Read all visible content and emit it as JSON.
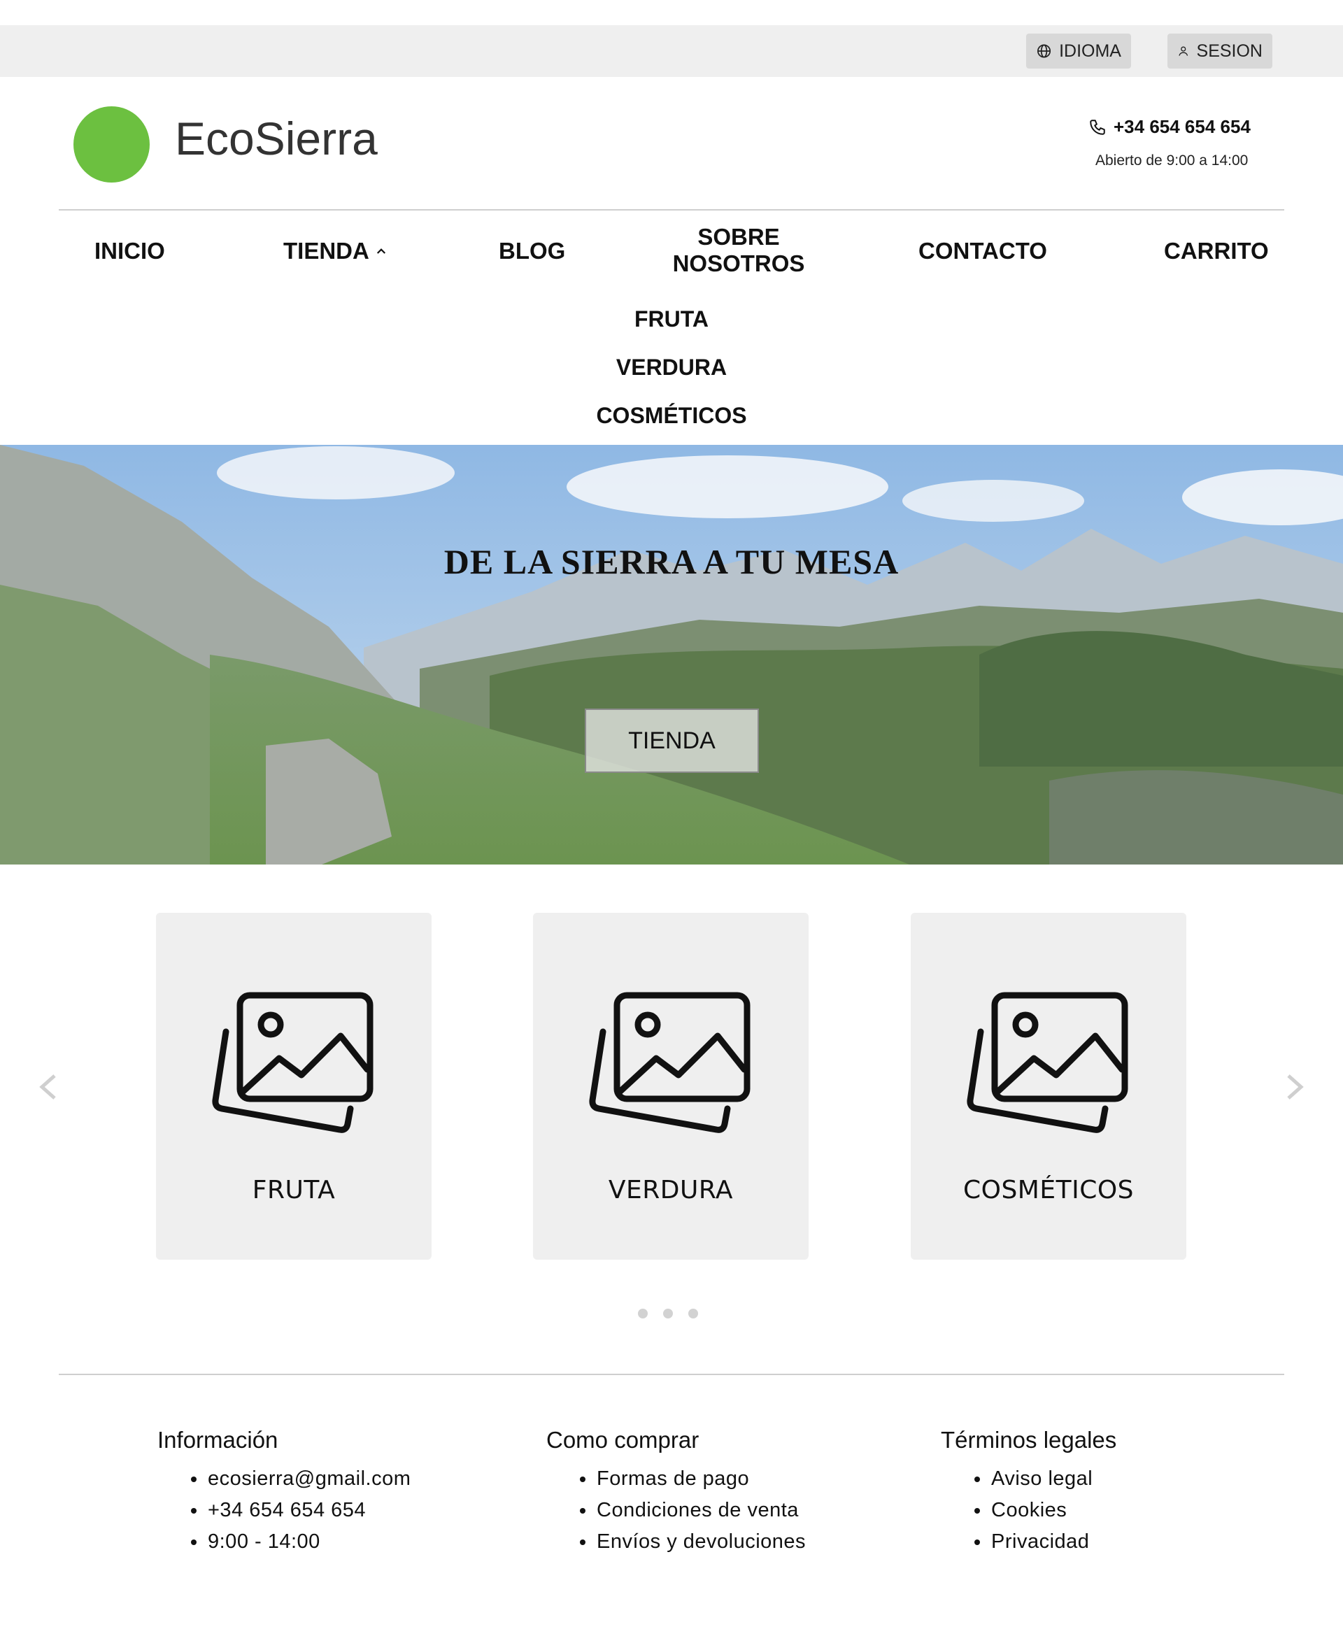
{
  "topbar": {
    "language_label": "IDIOMA",
    "session_label": "SESION"
  },
  "header": {
    "brand": "EcoSierra",
    "logo_color": "#6cc040",
    "phone": "+34 654 654 654",
    "hours": "Abierto de 9:00 a 14:00"
  },
  "nav": {
    "items": [
      "INICIO",
      "TIENDA",
      "BLOG",
      "SOBRE NOSOTROS",
      "CONTACTO",
      "CARRITO"
    ],
    "tienda_submenu": [
      "FRUTA",
      "VERDURA",
      "COSMÉTICOS"
    ]
  },
  "hero": {
    "title": "DE LA SIERRA A TU MESA",
    "button_label": "TIENDA"
  },
  "carousel": {
    "cards": [
      {
        "label": "FRUTA",
        "icon": "image-gallery-icon"
      },
      {
        "label": "VERDURA",
        "icon": "image-gallery-icon"
      },
      {
        "label": "COSMÉTICOS",
        "icon": "image-gallery-icon"
      }
    ],
    "dot_count": 3
  },
  "footer": {
    "columns": [
      {
        "title": "Información",
        "items": [
          "ecosierra@gmail.com",
          "+34 654 654 654",
          "9:00 - 14:00"
        ]
      },
      {
        "title": "Como comprar",
        "items": [
          "Formas de pago",
          "Condiciones de venta",
          "Envíos y devoluciones"
        ]
      },
      {
        "title": "Términos legales",
        "items": [
          "Aviso legal",
          "Cookies",
          "Privacidad"
        ]
      }
    ]
  }
}
